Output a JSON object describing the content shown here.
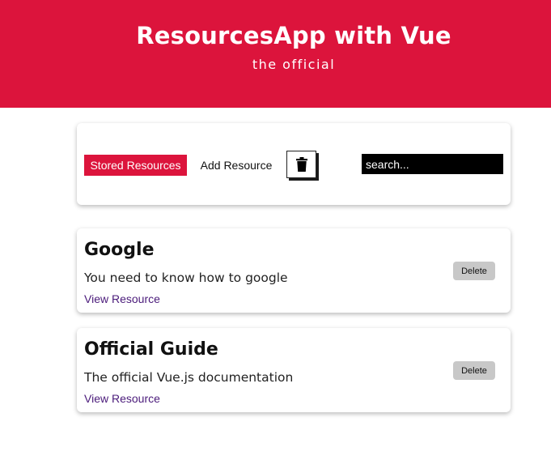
{
  "header": {
    "title": "ResourcesApp with Vue",
    "subtitle": "the official",
    "background_color": "#dc143c"
  },
  "toolbar": {
    "stored_label": "Stored Resources",
    "add_label": "Add Resource",
    "trash_icon": "trash-icon",
    "search_placeholder": "search...",
    "search_value": ""
  },
  "resources": [
    {
      "title": "Google",
      "description": "You need to know how to google",
      "link_label": "View Resource",
      "delete_label": "Delete"
    },
    {
      "title": "Official Guide",
      "description": "The official Vue.js documentation",
      "link_label": "View Resource",
      "delete_label": "Delete"
    }
  ]
}
